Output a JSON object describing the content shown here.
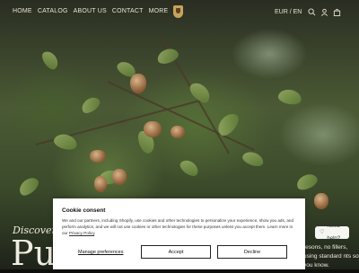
{
  "nav": {
    "items": [
      {
        "label": "HOME"
      },
      {
        "label": "CATALOG"
      },
      {
        "label": "ABOUT US"
      },
      {
        "label": "CONTACT"
      },
      {
        "label": "MORE"
      }
    ],
    "locale": "EUR / EN",
    "icons": [
      "search-icon",
      "user-icon",
      "bag-icon"
    ]
  },
  "hero": {
    "eyebrow": "Discover",
    "title": "Pu",
    "side_text": "resons, no fillers, using standard nts so you know."
  },
  "help_button": {
    "label": "Need help?"
  },
  "consent": {
    "title": "Cookie consent",
    "body": "We and our partners, including Shopify, use cookies and other technologies to personalize your experience, show you ads, and perform analytics, and we will not use cookies or other technologies for these purposes unless you accept them. Learn more in our",
    "policy_link": "Privacy Policy",
    "manage_label": "Manage preferences",
    "accept_label": "Accept",
    "decline_label": "Decline"
  },
  "colors": {
    "logo": "#c9a35a",
    "nav_text": "#e8e2d4"
  }
}
